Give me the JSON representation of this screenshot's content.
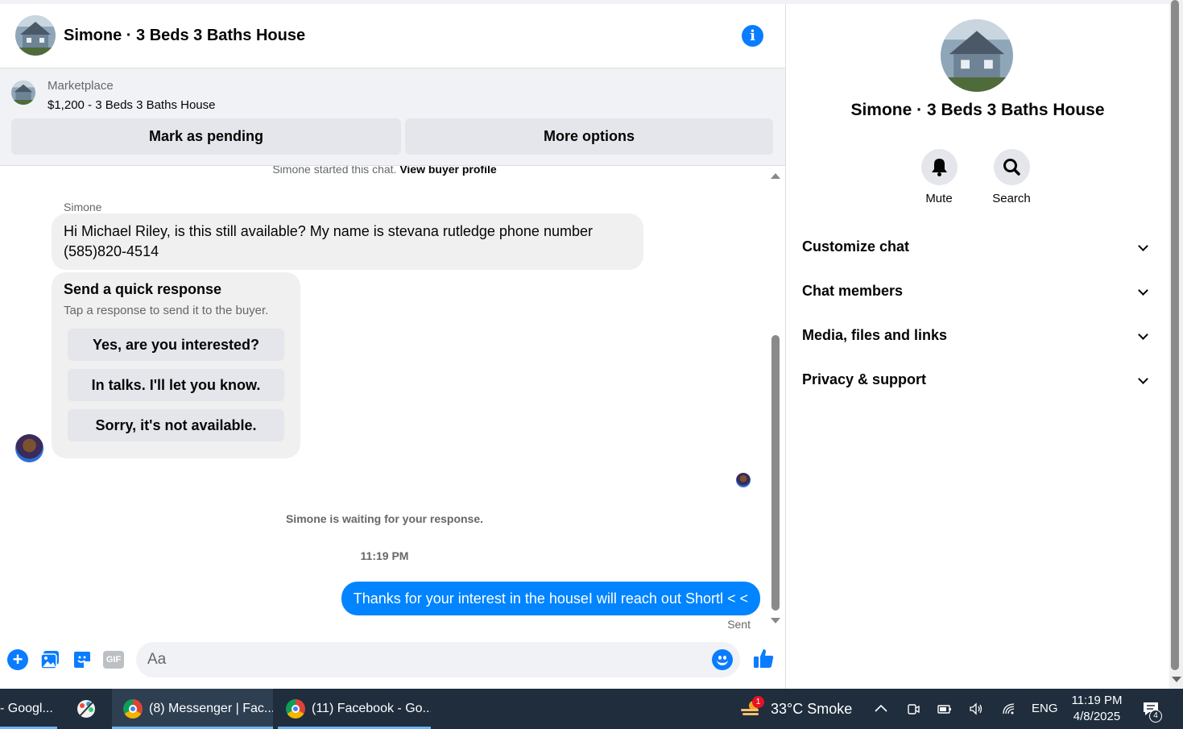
{
  "chat": {
    "title": "Simone · 3 Beds 3 Baths House",
    "listing_category": "Marketplace",
    "listing_name": "$1,200 - 3 Beds 3 Baths House",
    "mark_pending_label": "Mark as pending",
    "more_options_label": "More options",
    "system_started": "Simone started this chat.",
    "view_buyer_profile": "View buyer profile",
    "sender_name": "Simone",
    "incoming_message": "Hi Michael Riley, is this still available? My name is stevana rutledge phone number (585)820-4514",
    "quick_response": {
      "title": "Send a quick response",
      "subtitle": "Tap a response to send it to the buyer.",
      "options": [
        "Yes, are you interested?",
        "In talks. I'll let you know.",
        "Sorry, it's not available."
      ]
    },
    "waiting_text": "Simone is waiting for your response.",
    "timestamp": "11:19 PM",
    "outgoing_message": "Thanks for your interest in the houseI will reach out Shortl < <",
    "sent_status": "Sent",
    "composer_placeholder": "Aa",
    "gif_label": "GIF"
  },
  "info": {
    "title": "Simone · 3 Beds 3 Baths House",
    "mute_label": "Mute",
    "search_label": "Search",
    "sections": [
      "Customize chat",
      "Chat members",
      "Media, files and links",
      "Privacy & support"
    ]
  },
  "taskbar": {
    "item_google": "- Googl...",
    "item_messenger": "(8) Messenger | Fac...",
    "item_facebook": "(11) Facebook - Go...",
    "weather_badge": "1",
    "weather": "33°C  Smoke",
    "language": "ENG",
    "time": "11:19 PM",
    "date": "4/8/2025",
    "notification_count": "4"
  },
  "colors": {
    "accent": "#0a7cff",
    "outgoing_bubble": "#0084ff",
    "taskbar": "#1f2d3d"
  }
}
